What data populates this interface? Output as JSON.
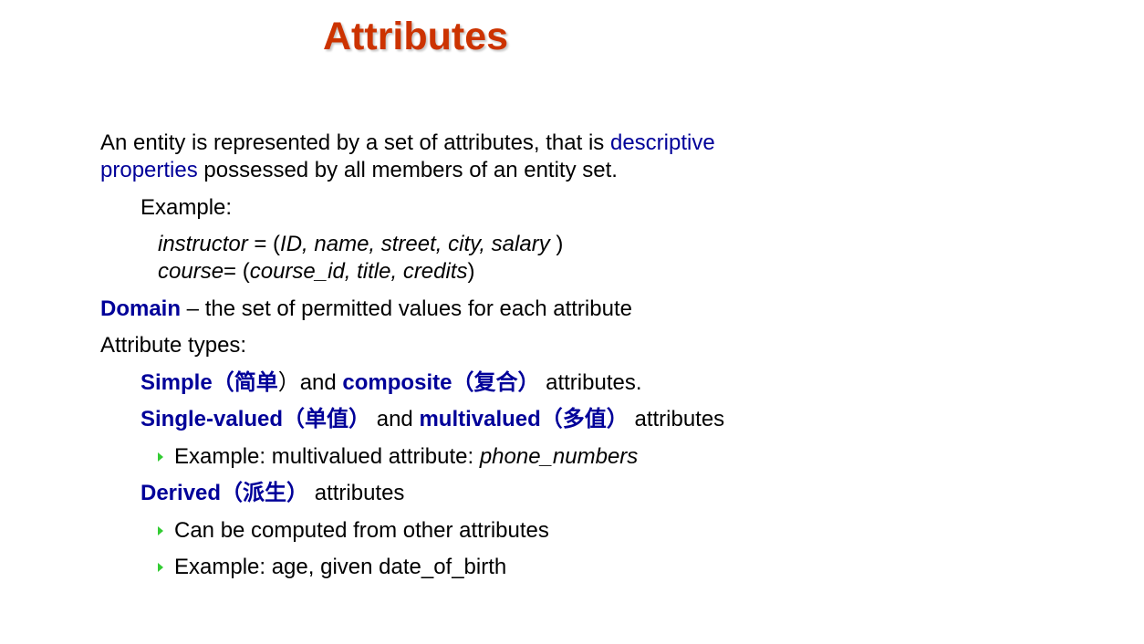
{
  "title": "Attributes",
  "colors": {
    "title": "#cc3300",
    "emphasis": "#000099",
    "bullet": "#33cc33",
    "text": "#000000"
  },
  "intro": {
    "part1": "An entity is represented by a set of attributes, that is ",
    "highlight_a": "descriptive",
    "highlight_b": "properties",
    "part2": " possessed by all members of an entity set."
  },
  "example_label": "Example:",
  "examples": {
    "instructor": {
      "name": "instructor",
      "eq": " = (",
      "fields": "ID, name, street, city, salary ",
      "close": ")"
    },
    "course": {
      "name": "course",
      "eq": "= (",
      "fields": "course_id, title, credits",
      "close": ")"
    }
  },
  "domain": {
    "term": "Domain",
    "definition": " – the set of permitted values for each attribute"
  },
  "attribute_types_label": "Attribute types:",
  "types": {
    "simple": {
      "term1": "Simple（简单",
      "mid": "）and ",
      "term2": "composite（复合）",
      "tail": " attributes."
    },
    "single": {
      "term1": "Single-valued（单值）",
      "mid": " and ",
      "term2": "multivalued（多值）",
      "tail": " attributes"
    },
    "single_example": {
      "text": "Example: multivalued attribute: ",
      "value": "phone_numbers"
    },
    "derived": {
      "term": "Derived（派生）",
      "tail": " attributes"
    },
    "derived_points": [
      "Can be computed from other attributes",
      "Example:  age, given date_of_birth"
    ]
  }
}
